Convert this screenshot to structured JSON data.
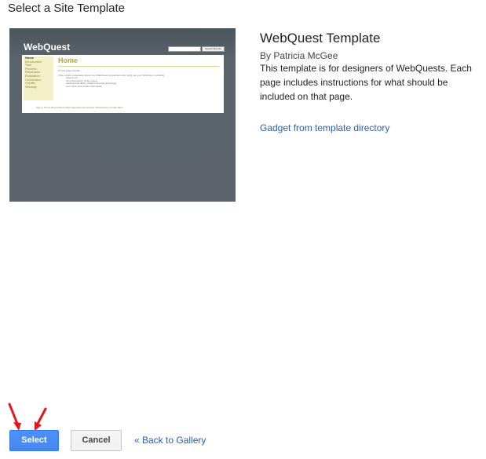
{
  "page": {
    "title": "Select a Site Template"
  },
  "thumbnail": {
    "brand": "WebQuest",
    "search_button": "Search this site",
    "nav_items": [
      "Home",
      "Introduction",
      "Task",
      "Process",
      "Resources",
      "Evaluation",
      "Conclusion",
      "Credits",
      "Sitemap"
    ],
    "heading": "Home",
    "intro": "On this page include:",
    "body": "Write a short explanation about your WebQuest for teachers who might use your WebQuest, including:",
    "bullets": [
      "grade level",
      "short description of the project",
      "teaching standards, subject area and technology",
      "your name and contact information"
    ],
    "footer": "Sign in  Terms  Report Abuse  Print page  Remove Access  |  Powered by  Google Sites"
  },
  "template": {
    "name": "WebQuest Template",
    "author": "By Patricia McGee",
    "description": "This template is for designers of WebQuests. Each page includes instructions for what should be included on that page.",
    "gadget_link": "Gadget from template directory"
  },
  "actions": {
    "select_label": "Select",
    "cancel_label": "Cancel",
    "back_label": "« Back to Gallery"
  },
  "colors": {
    "accent": "#4d90fe",
    "link": "#2a5db0",
    "arrow": "#e8161c"
  }
}
